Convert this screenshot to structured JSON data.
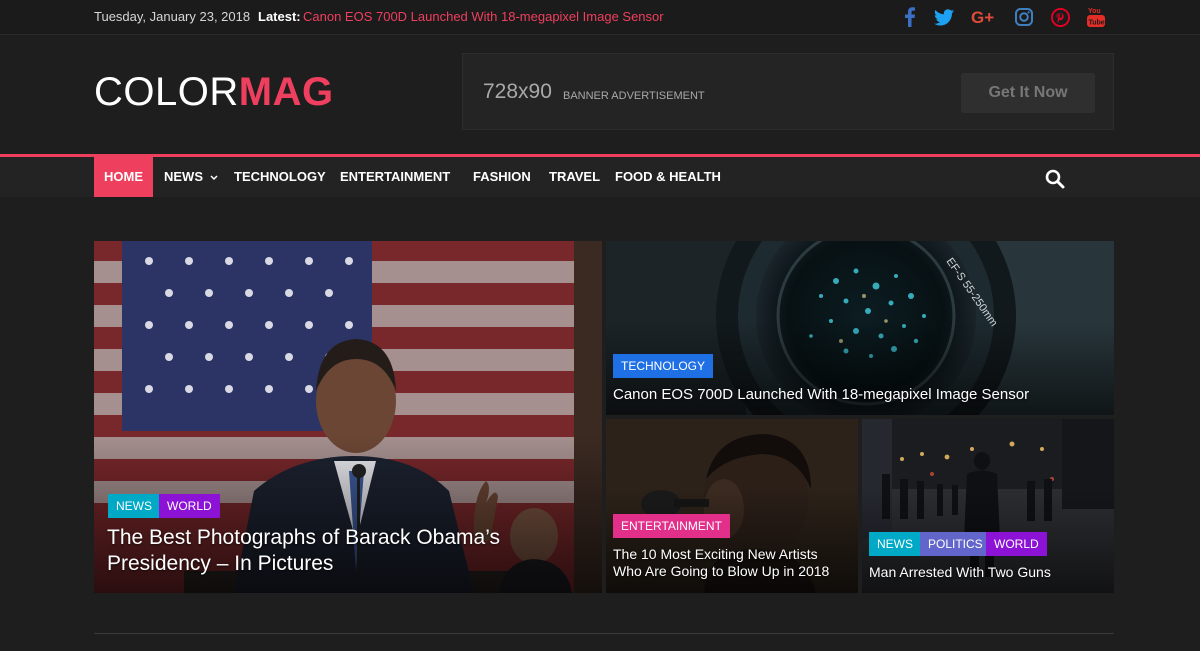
{
  "topbar": {
    "date": "Tuesday, January 23, 2018",
    "latest_label": "Latest:",
    "latest_link": "Canon EOS 700D Launched With 18-megapixel Image Sensor"
  },
  "social_icons": [
    "facebook-icon",
    "twitter-icon",
    "google-plus-icon",
    "instagram-icon",
    "pinterest-icon",
    "youtube-icon"
  ],
  "logo": {
    "part_a": "COLOR",
    "part_b": "MAG"
  },
  "banner": {
    "size": "728x90",
    "label": "BANNER ADVERTISEMENT",
    "button": "Get It Now"
  },
  "nav": {
    "items": [
      {
        "label": "HOME"
      },
      {
        "label": "NEWS"
      },
      {
        "label": "TECHNOLOGY"
      },
      {
        "label": "ENTERTAINMENT"
      },
      {
        "label": "FASHION"
      },
      {
        "label": "TRAVEL"
      },
      {
        "label": "FOOD & HEALTH"
      }
    ]
  },
  "featured": {
    "main": {
      "tags": [
        "NEWS",
        "WORLD"
      ],
      "title_line1": "The Best Photographs of Barack Obama’s",
      "title_line2": "Presidency – In Pictures"
    },
    "top_right": {
      "tag": "TECHNOLOGY",
      "title": "Canon EOS 700D Launched With 18-megapixel Image Sensor"
    },
    "bottom_left": {
      "tag": "ENTERTAINMENT",
      "title_line1": "The 10 Most Exciting New Artists",
      "title_line2": "Who Are Going to Blow Up in 2018"
    },
    "bottom_right": {
      "tags": [
        "NEWS",
        "POLITICS",
        "WORLD"
      ],
      "title": "Man Arrested With Two Guns"
    }
  },
  "colors": {
    "accent": "#ef3f5e",
    "background": "#1e1e1e",
    "news": "#00a9c5",
    "world": "#8c13d6",
    "technology": "#1f6fe5",
    "entertainment": "#e2308a",
    "politics": "#6265c9"
  }
}
